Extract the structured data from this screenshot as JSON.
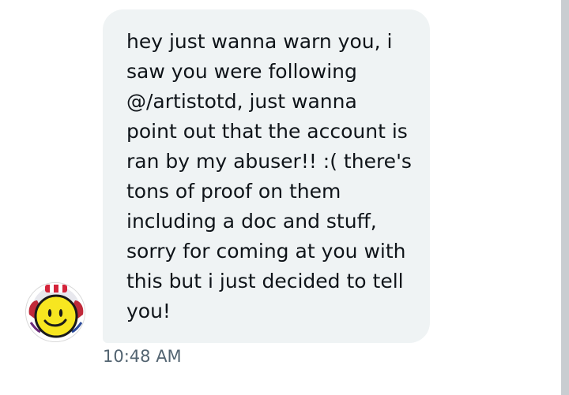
{
  "message": {
    "text": "hey just wanna warn you, i\nsaw you were following\n@/artistotd, just wanna\npoint out that the account is\nran by my abuser!! :( there's\ntons of proof on them\nincluding a doc and stuff,\nsorry for coming at you with\nthis but i just decided to tell\nyou!",
    "timestamp": "10:48 AM"
  },
  "sender": {
    "avatar_icon": "smiley-face-icon"
  },
  "colors": {
    "bubble": "#eff3f4",
    "text": "#0f1419",
    "timestamp": "#536471",
    "scrollbar": "#c9cdd1"
  }
}
